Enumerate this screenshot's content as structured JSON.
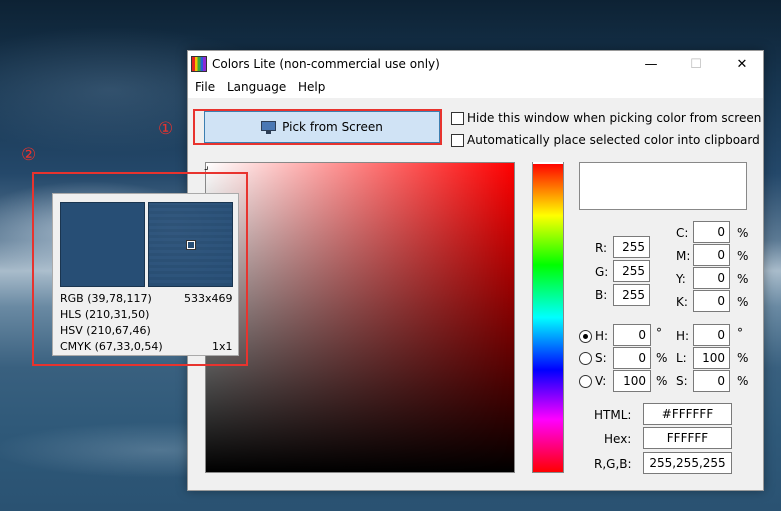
{
  "window": {
    "title": "Colors Lite (non-commercial use only)",
    "menu": [
      "File",
      "Language",
      "Help"
    ],
    "pick_button": "Pick from Screen",
    "options": [
      "Hide this window when picking color from screen",
      "Automatically place selected color into clipboard"
    ]
  },
  "rgb": {
    "r_label": "R:",
    "g_label": "G:",
    "b_label": "B:",
    "r": "255",
    "g": "255",
    "b": "255"
  },
  "cmyk": {
    "c_label": "C:",
    "m_label": "M:",
    "y_label": "Y:",
    "k_label": "K:",
    "c": "0",
    "m": "0",
    "y": "0",
    "k": "0",
    "unit": "%"
  },
  "hsv": {
    "h_label": "H:",
    "s_label": "S:",
    "v_label": "V:",
    "h": "0",
    "s": "0",
    "v": "100",
    "selected": "H",
    "deg": "°",
    "pct": "%"
  },
  "hls": {
    "h_label": "H:",
    "l_label": "L:",
    "s_label": "S:",
    "h": "0",
    "l": "100",
    "s": "0",
    "deg": "°",
    "pct": "%"
  },
  "codes": {
    "html_label": "HTML:",
    "html": "#FFFFFF",
    "hex_label": "Hex:",
    "hex": "FFFFFF",
    "rgb_label": "R,G,B:",
    "rgb": "255,255,255"
  },
  "magnifier": {
    "rgb": "RGB (39,78,117)",
    "position": "533x469",
    "hls": "HLS (210,31,50)",
    "hsv": "HSV (210,67,46)",
    "cmyk": "CMYK (67,33,0,54)",
    "zoom": "1x1",
    "swatch_color": "#274E75"
  },
  "annotations": [
    "①",
    "②"
  ],
  "colors": {
    "annotation_red": "#E8332E",
    "button_blue": "#D0E3F5"
  }
}
